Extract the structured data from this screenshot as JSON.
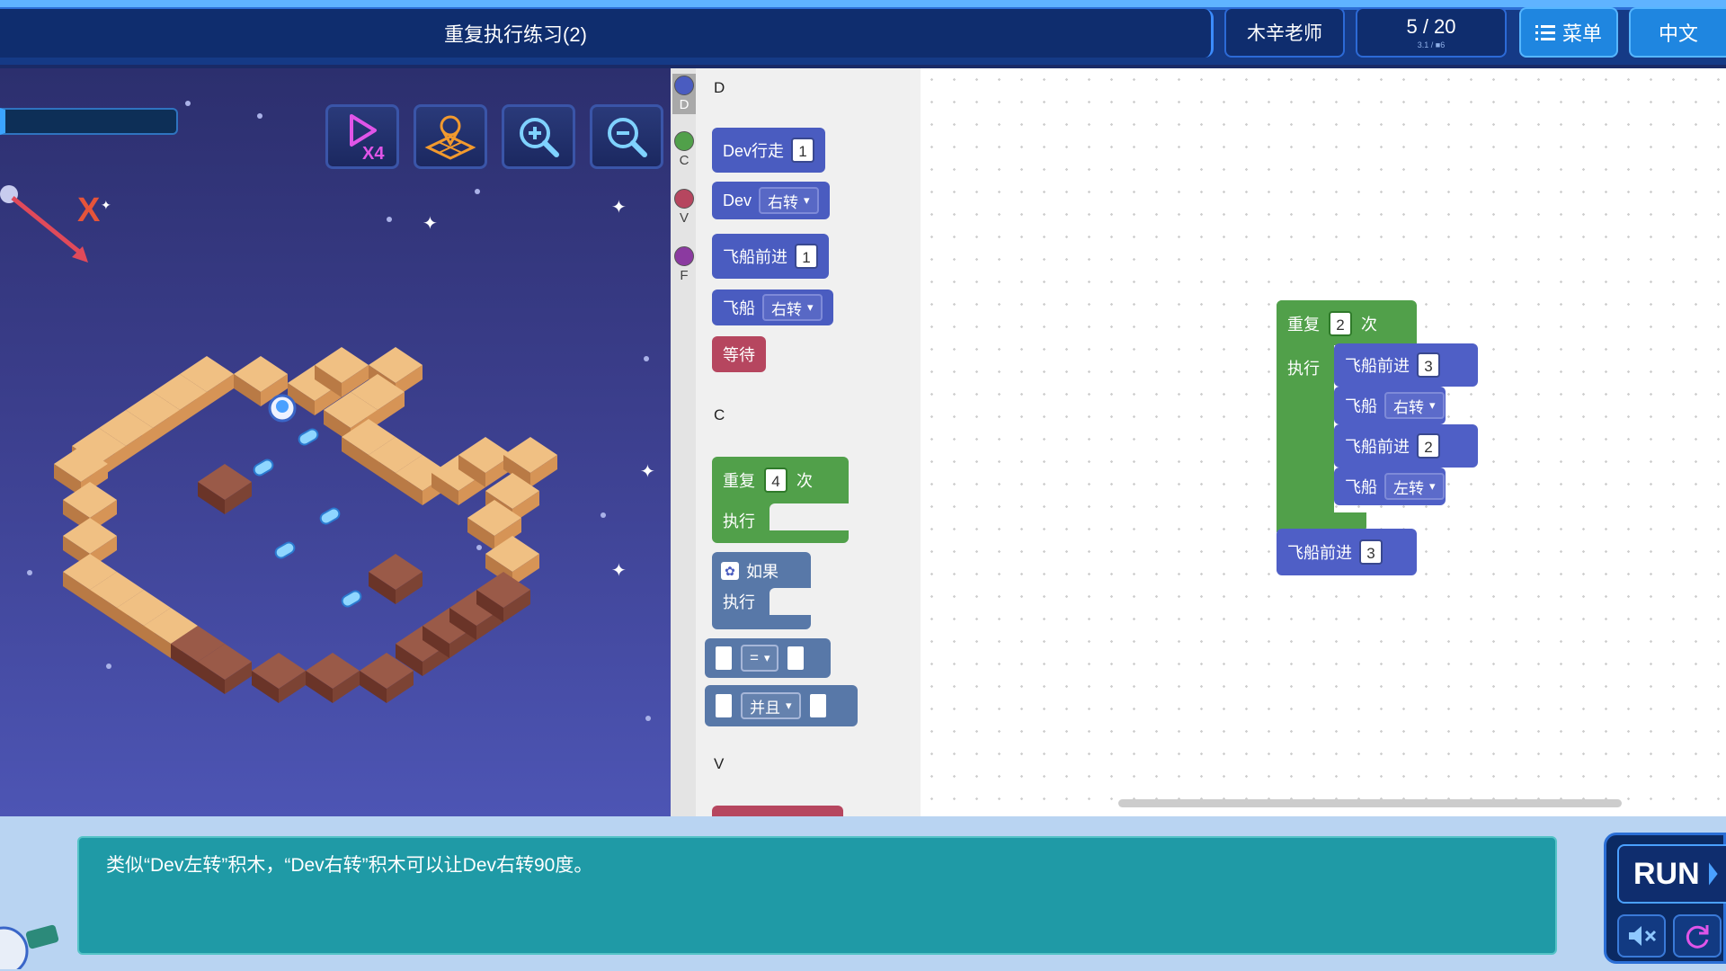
{
  "header": {
    "title": "重复执行练习(2)",
    "teacher": "木辛老师",
    "progress": "5 / 20",
    "progress_sub": "3.1 / ■6",
    "menu_label": "菜单",
    "lang_label": "中文"
  },
  "game": {
    "tools": [
      {
        "name": "speed-x4-icon",
        "text": "X4"
      },
      {
        "name": "map-pin-icon"
      },
      {
        "name": "zoom-in-icon"
      },
      {
        "name": "zoom-out-icon"
      }
    ],
    "axis_x_label": "X"
  },
  "toolbox": {
    "categories": [
      {
        "label": "D",
        "color": "#4a5cc0"
      },
      {
        "label": "C",
        "color": "#51a04a"
      },
      {
        "label": "V",
        "color": "#b6465f"
      },
      {
        "label": "F",
        "color": "#8b3aa0"
      }
    ],
    "section_d": "D",
    "section_c": "C",
    "section_v": "V",
    "dev_walk": {
      "label": "Dev行走",
      "value": "1"
    },
    "dev_turn": {
      "label": "Dev",
      "option": "右转"
    },
    "ship_forward": {
      "label": "飞船前进",
      "value": "1"
    },
    "ship_turn": {
      "label": "飞船",
      "option": "右转"
    },
    "wait": {
      "label": "等待"
    },
    "repeat": {
      "label": "重复",
      "value": "4",
      "suffix": "次",
      "do": "执行"
    },
    "if": {
      "label": "如果",
      "do": "执行"
    },
    "compare": {
      "option": "="
    },
    "logic": {
      "option": "并且"
    }
  },
  "workspace": {
    "repeat": {
      "label": "重复",
      "value": "2",
      "suffix": "次",
      "do": "执行"
    },
    "inner": [
      {
        "label": "飞船前进",
        "value": "3"
      },
      {
        "label": "飞船",
        "option": "右转"
      },
      {
        "label": "飞船前进",
        "value": "2"
      },
      {
        "label": "飞船",
        "option": "左转"
      }
    ],
    "after": {
      "label": "飞船前进",
      "value": "3"
    }
  },
  "dialog": {
    "message": "类似“Dev左转”积木，“Dev右转”积木可以让Dev右转90度。"
  },
  "controls": {
    "run_label": "RUN"
  },
  "colors": {
    "accent": "#1f86e0",
    "block_motion": "#4a5cc0",
    "block_control": "#51a04a",
    "block_wait": "#b6465f",
    "dialog_bg": "#1f9aa6"
  }
}
